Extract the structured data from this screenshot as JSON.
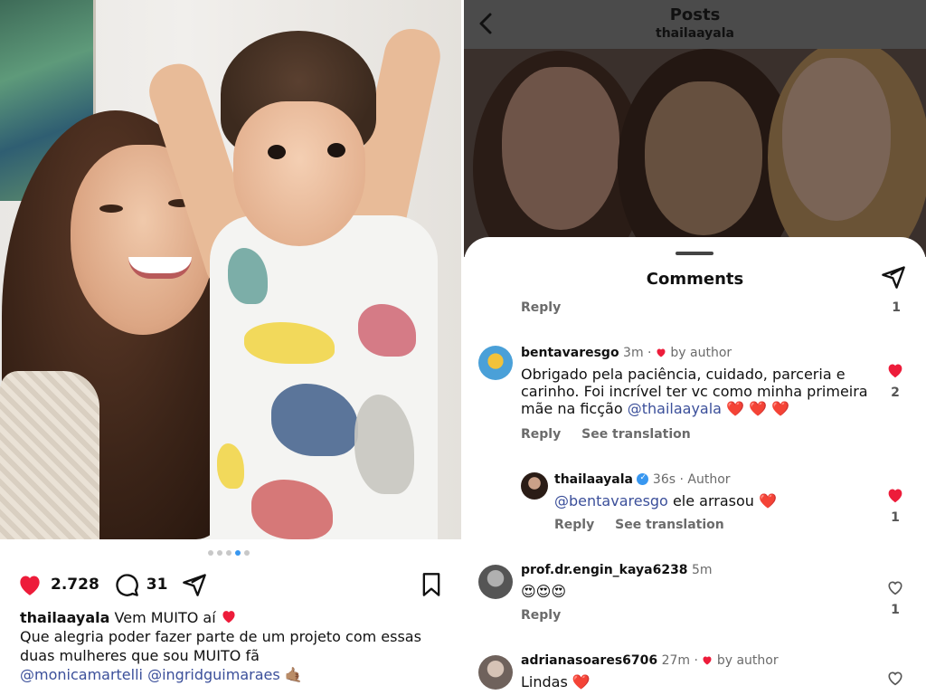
{
  "left_post": {
    "likes": "2.728",
    "comments": "31",
    "carousel": {
      "count": 5,
      "active": 4
    },
    "caption": {
      "username": "thailaayala",
      "line1": "Vem MUITO aí",
      "line2": "Que alegria poder fazer parte de um projeto com essas",
      "line3": "duas mulheres que sou MUITO fã",
      "mention1": "@monicamartelli",
      "mention2": "@ingridguimaraes",
      "emoji": "🤙🏽"
    },
    "icons": [
      "heart-icon",
      "comment-icon",
      "share-icon",
      "bookmark-icon"
    ]
  },
  "right_panel": {
    "header": {
      "title": "Posts",
      "subtitle": "thailaayala"
    },
    "sheet_title": "Comments",
    "prev_reply": {
      "reply_label": "Reply",
      "likes": "1"
    },
    "comments": [
      {
        "username": "bentavaresgo",
        "time": "3m",
        "by_author": "by author",
        "text_line1": "Obrigado pela paciência, cuidado, parceria e",
        "text_line2": "carinho. Foi incrível ter vc como minha primeira",
        "text_line3_pre": "mãe na ficção",
        "text_mention": "@thailaayala",
        "text_emoji": "❤️ ❤️ ❤️",
        "reply_label": "Reply",
        "translate_label": "See translation",
        "likes": "2",
        "liked": true
      },
      {
        "username": "thailaayala",
        "time": "36s",
        "role": "Author",
        "text_mention": "@bentavaresgo",
        "text_rest": "ele arrasou",
        "text_emoji": "❤️",
        "reply_label": "Reply",
        "translate_label": "See translation",
        "likes": "1",
        "liked": true
      },
      {
        "username": "prof.dr.engin_kaya6238",
        "time": "5m",
        "text": "😍😍😍",
        "reply_label": "Reply",
        "likes": "1",
        "liked": false
      },
      {
        "username": "adrianasoares6706",
        "time": "27m",
        "by_author": "by author",
        "text": "Lindas",
        "text_emoji": "❤️",
        "liked": false
      }
    ],
    "colors": {
      "like_red": "#ed1c3a",
      "mention_blue": "#3b4f9a",
      "verified_blue": "#3897f0"
    }
  }
}
